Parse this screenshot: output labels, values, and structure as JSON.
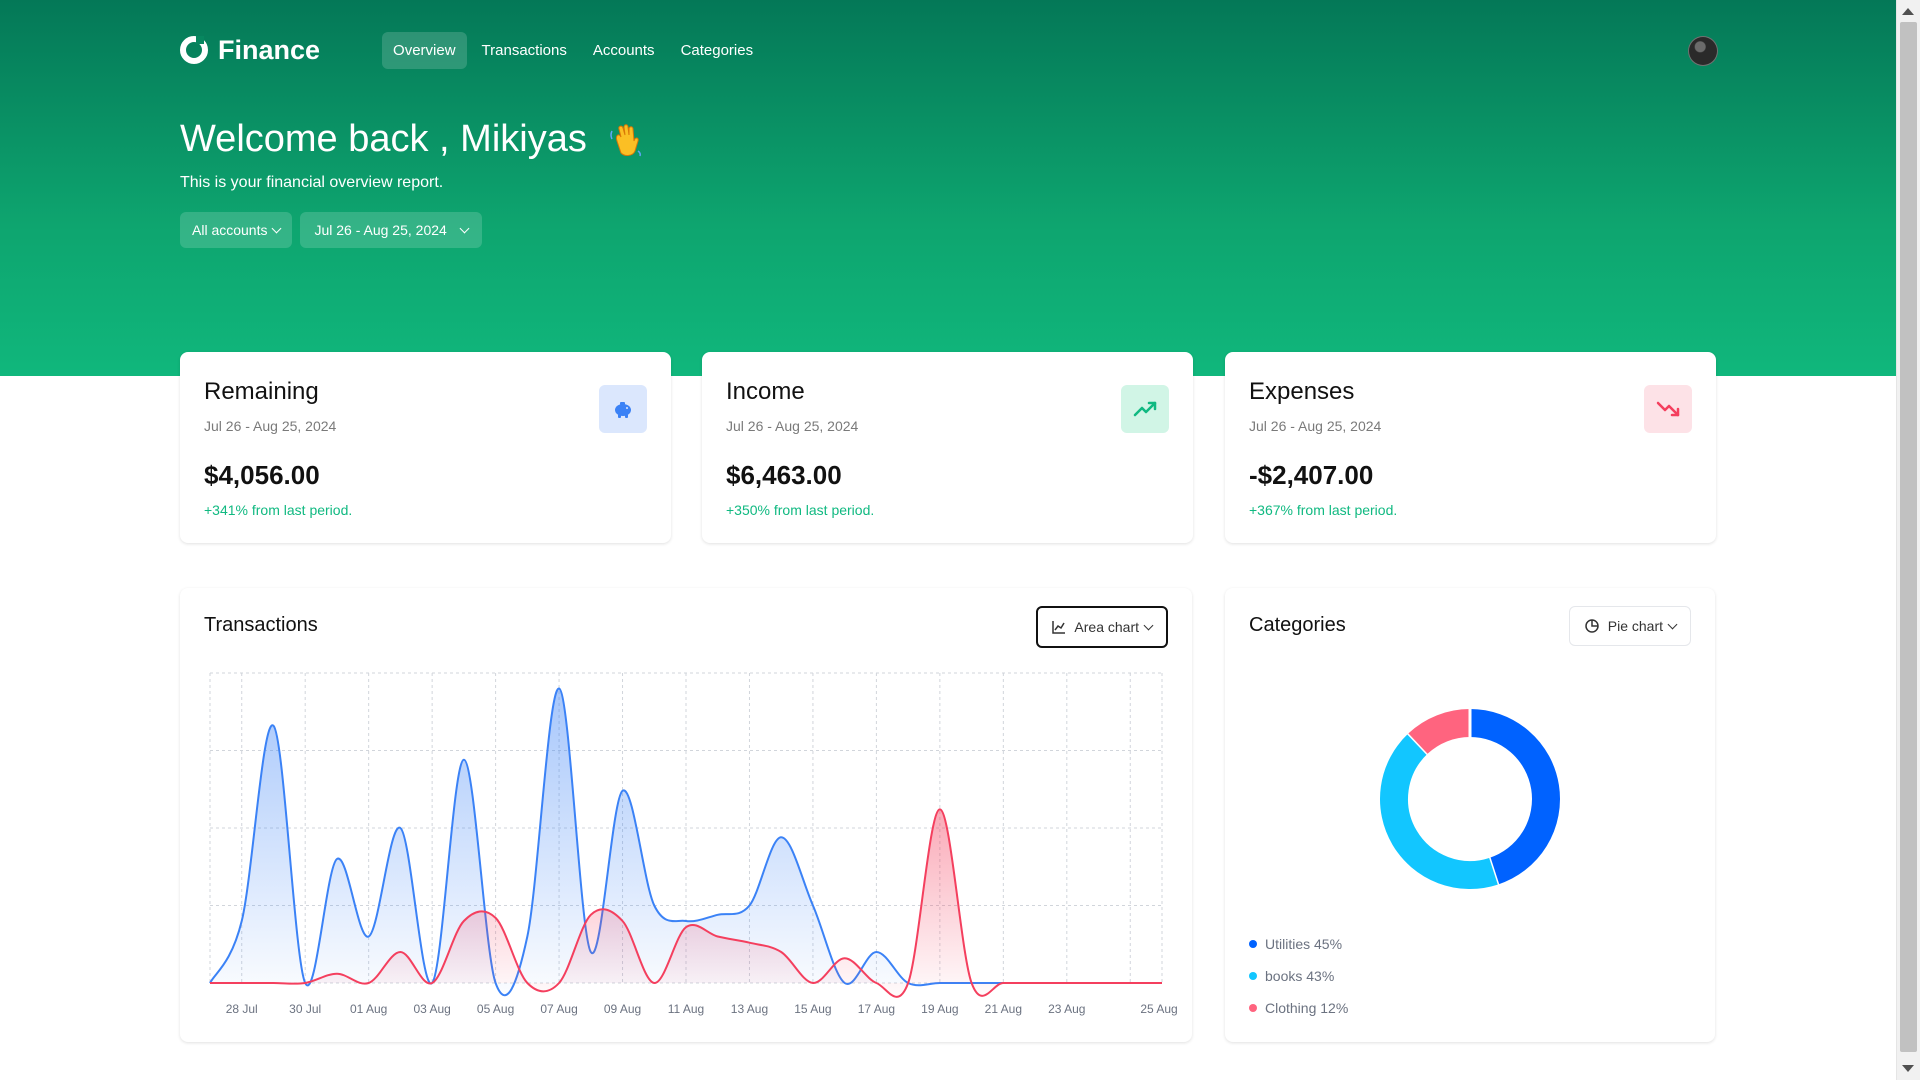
{
  "nav": {
    "brand": "Finance",
    "links": [
      "Overview",
      "Transactions",
      "Accounts",
      "Categories"
    ],
    "active": "Overview"
  },
  "header": {
    "welcome": "Welcome back , Mikiyas",
    "subtitle": "This is your financial overview report.",
    "account_filter": "All accounts",
    "date_filter": "Jul 26 - Aug 25, 2024"
  },
  "cards": {
    "remaining": {
      "title": "Remaining",
      "range": "Jul 26 - Aug 25, 2024",
      "value": "$4,056.00",
      "change": "+341% from last period.",
      "icon": "piggy-bank-icon"
    },
    "income": {
      "title": "Income",
      "range": "Jul 26 - Aug 25, 2024",
      "value": "$6,463.00",
      "change": "+350% from last period.",
      "icon": "trending-up-icon"
    },
    "expenses": {
      "title": "Expenses",
      "range": "Jul 26 - Aug 25, 2024",
      "value": "-$2,407.00",
      "change": "+367% from last period.",
      "icon": "trending-down-icon"
    }
  },
  "transactions": {
    "title": "Transactions",
    "chart_select": "Area chart"
  },
  "categories": {
    "title": "Categories",
    "chart_select": "Pie chart",
    "legend": [
      {
        "label": "Utilities 45%",
        "color": "#0062ff"
      },
      {
        "label": "books 43%",
        "color": "#12c6ff"
      },
      {
        "label": "Clothing 12%",
        "color": "#ff647f"
      }
    ]
  },
  "colors": {
    "accent": "#10b981",
    "income": "#3b82f6",
    "expense": "#f43f5e"
  },
  "chart_data": [
    {
      "type": "area",
      "x_ticks": [
        "28 Jul",
        "30 Jul",
        "01 Aug",
        "03 Aug",
        "05 Aug",
        "07 Aug",
        "09 Aug",
        "11 Aug",
        "13 Aug",
        "15 Aug",
        "17 Aug",
        "19 Aug",
        "21 Aug",
        "23 Aug",
        "25 Aug"
      ],
      "grid": true,
      "series": [
        {
          "color": "#3b82f6",
          "values": [
            0,
            0.2,
            0.83,
            0,
            0.4,
            0.15,
            0.5,
            0,
            0.72,
            0,
            0.15,
            0.95,
            0.1,
            0.62,
            0.25,
            0.2,
            0.22,
            0.25,
            0.47,
            0.25,
            0,
            0.1,
            0,
            0,
            0,
            0,
            0,
            0,
            0,
            0,
            0
          ]
        },
        {
          "color": "#f43f5e",
          "values": [
            0,
            0,
            0,
            0,
            0.03,
            0,
            0.1,
            0,
            0.2,
            0.21,
            0,
            0,
            0.22,
            0.2,
            0,
            0.18,
            0.15,
            0.13,
            0.1,
            0,
            0.08,
            0,
            0,
            0.56,
            0,
            0,
            0,
            0,
            0,
            0,
            0
          ]
        }
      ]
    },
    {
      "type": "pie",
      "labels": [
        "Utilities",
        "books",
        "Clothing"
      ],
      "values": [
        45,
        43,
        12
      ],
      "colors": [
        "#0062ff",
        "#12c6ff",
        "#ff647f"
      ]
    }
  ]
}
